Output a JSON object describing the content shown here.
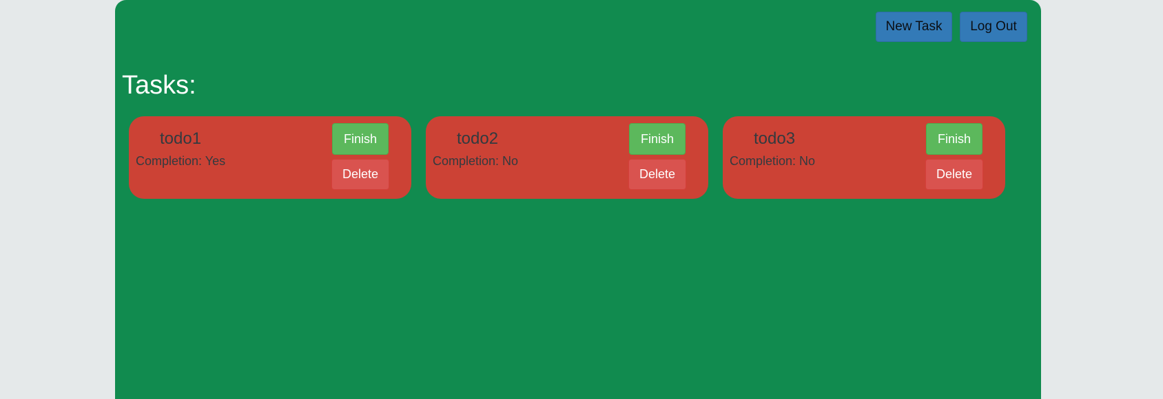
{
  "header": {
    "new_task_label": "New Task",
    "logout_label": "Log Out"
  },
  "main": {
    "title": "Tasks:"
  },
  "tasks": [
    {
      "name": "todo1",
      "completion": "Completion: Yes",
      "finish_label": "Finish",
      "delete_label": "Delete"
    },
    {
      "name": "todo2",
      "completion": "Completion: No",
      "finish_label": "Finish",
      "delete_label": "Delete"
    },
    {
      "name": "todo3",
      "completion": "Completion: No",
      "finish_label": "Finish",
      "delete_label": "Delete"
    }
  ],
  "colors": {
    "page_background": "#e5e9ea",
    "app_background": "#118b4f",
    "header_button": "#337ab7",
    "card_background": "#cc4235",
    "finish_button": "#5cb85c",
    "delete_button": "#d9534f"
  }
}
